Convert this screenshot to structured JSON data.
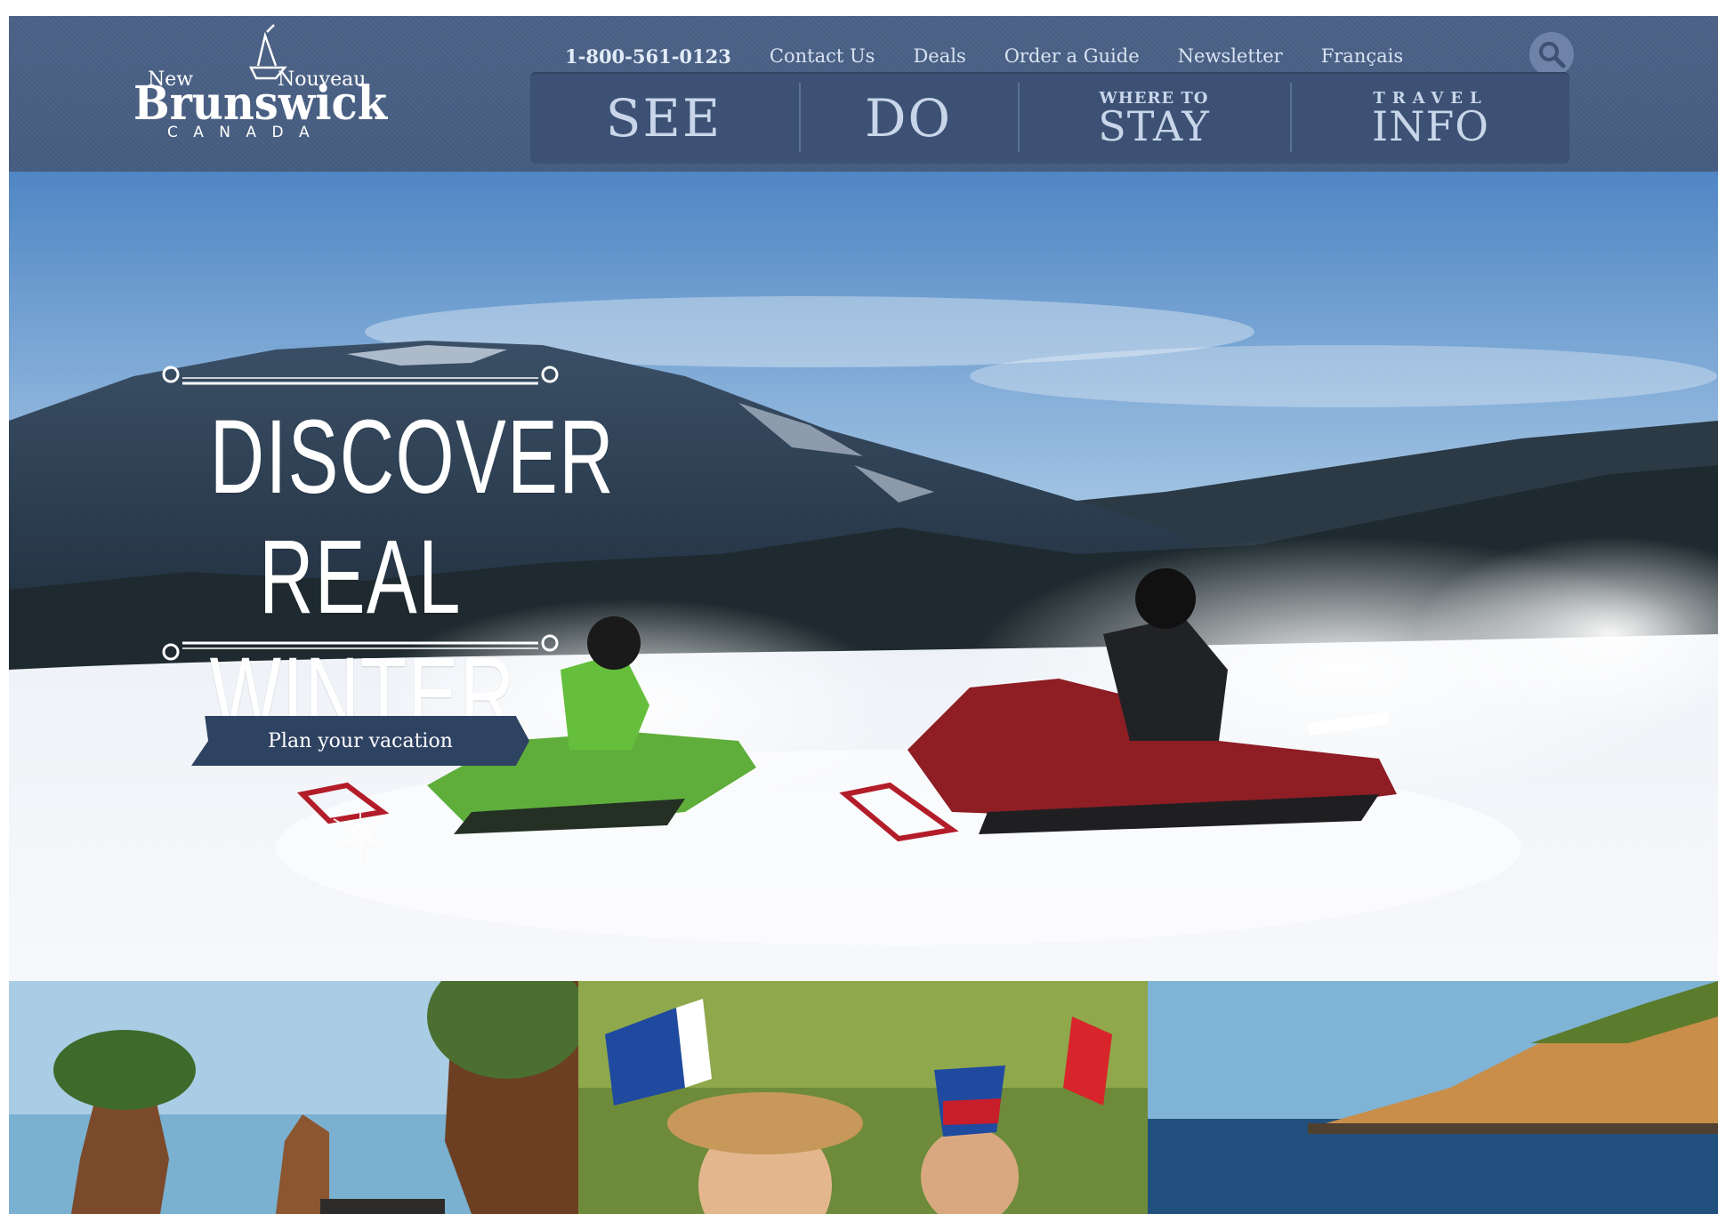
{
  "brand": {
    "logo_new": "New",
    "logo_nouveau": "Nouveau",
    "logo_brunswick": "Brunswick",
    "logo_canada": "C A N A D A"
  },
  "utility_nav": {
    "phone": "1-800-561-0123",
    "links": [
      "Contact Us",
      "Deals",
      "Order a Guide",
      "Newsletter",
      "Français"
    ]
  },
  "main_nav": {
    "see": "SEE",
    "do": "DO",
    "stay_small": "WHERE TO",
    "stay_big": "STAY",
    "info_small": "TRAVEL",
    "info_big": "INFO"
  },
  "hero": {
    "headline_line1": "DISCOVER",
    "headline_line2": "REAL WINTER",
    "cta_label": "Plan your vacation"
  },
  "colors": {
    "header_bg": "#475d82",
    "nav_bg": "#3c5174",
    "nav_text": "#c9d6ea",
    "cta_bg": "#2e4262"
  },
  "icons": {
    "search": "search-icon"
  }
}
